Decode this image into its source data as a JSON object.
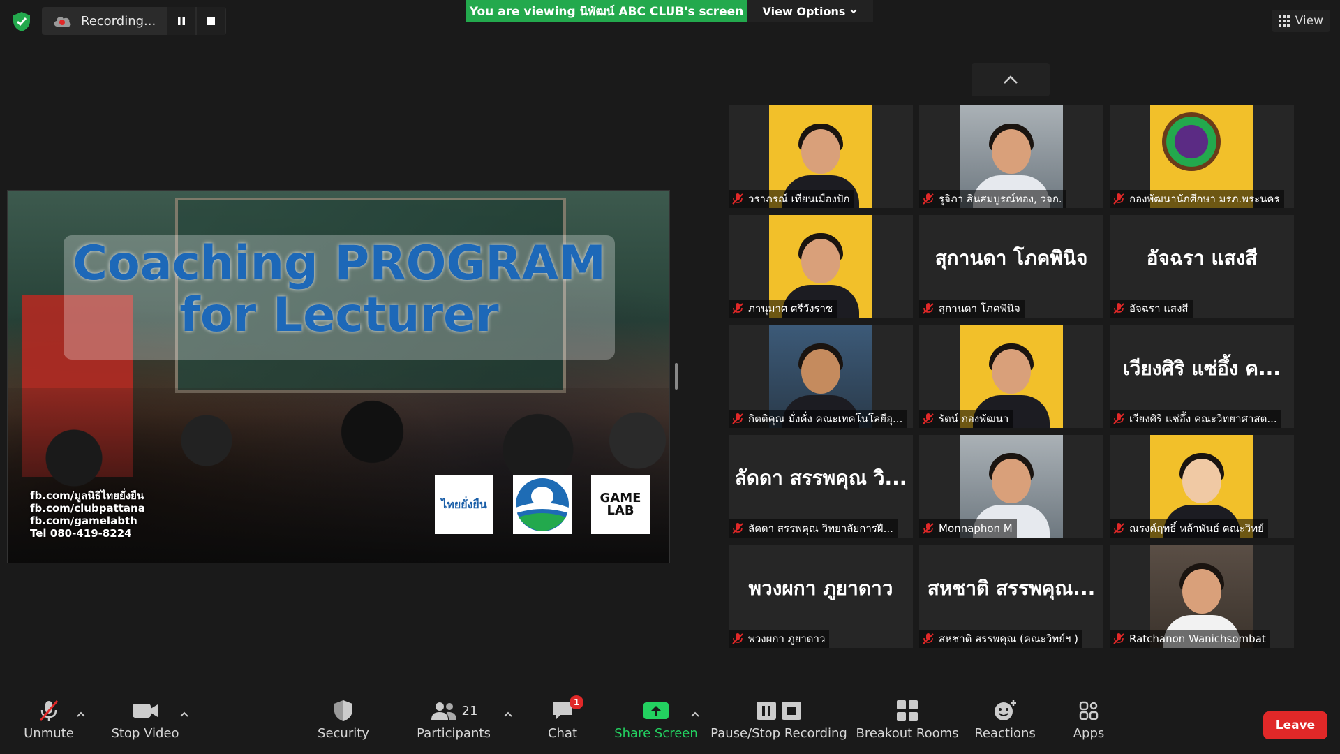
{
  "recording": {
    "label": "Recording..."
  },
  "banner": {
    "viewing": "You are viewing นิพัฒน์ ABC CLUB's screen",
    "view_options": "View Options"
  },
  "view_top": {
    "label": "View"
  },
  "slide": {
    "title_line1": "Coaching PROGRAM",
    "title_line2": "for Lecturer",
    "contacts": [
      "fb.com/มูลนิธิไทยยั่งยืน",
      "fb.com/clubpattana",
      "fb.com/gamelabth",
      "Tel 080-419-8224"
    ],
    "logo1_text": "ไทยยั่งยืน",
    "logo3_text": "GAME LAB"
  },
  "participants": [
    {
      "name": "วราภรณ์ เทียนเมืองปัก",
      "type": "photo-yellow"
    },
    {
      "name": "รุจิภา สินสมบูรณ์ทอง, วจก.",
      "type": "photo"
    },
    {
      "name": "กองพัฒนานักศึกษา มรภ.พระนคร",
      "type": "logo-yellow"
    },
    {
      "name": "ภานุมาศ ศรีวังราช",
      "type": "photo-yellow"
    },
    {
      "name": "สุกานดา โภคพินิจ",
      "display": "สุกานดา โภคพินิจ",
      "type": "name"
    },
    {
      "name": "อัจฉรา แสงสี",
      "display": "อัจฉรา แสงสี",
      "type": "name"
    },
    {
      "name": "กิตติคุณ มั่งคั่ง คณะเทคโนโลยีอุ...",
      "type": "cartoon"
    },
    {
      "name": "รัตน์ กองพัฒนา",
      "type": "photo-yellow"
    },
    {
      "name": "เวียงศิริ แซ่อึ้ง คณะวิทยาศาสต...",
      "display": "เวียงศิริ แซ่อึ้ง ค...",
      "type": "name"
    },
    {
      "name": "ลัดดา สรรพคุณ วิทยาลัยการฝี...",
      "display": "ลัดดา สรรพคุณ วิ...",
      "type": "name"
    },
    {
      "name": "Monnaphon M",
      "type": "photo"
    },
    {
      "name": "ณรงค์ฤทธิ์ หล้าพันธ์ คณะวิทย์",
      "type": "cartoon-yellow"
    },
    {
      "name": "พวงผกา ภูยาดาว",
      "display": "พวงผกา ภูยาดาว",
      "type": "name"
    },
    {
      "name": "สหชาติ สรรพคุณ (คณะวิทย์ฯ )",
      "display": "สหชาติ สรรพคุณ...",
      "type": "name"
    },
    {
      "name": "Ratchanon Wanichsombat",
      "type": "restaurant"
    }
  ],
  "toolbar": {
    "unmute": "Unmute",
    "stop_video": "Stop Video",
    "security": "Security",
    "participants": "Participants",
    "participants_count": "21",
    "chat": "Chat",
    "chat_badge": "1",
    "share_screen": "Share Screen",
    "pause_stop_recording": "Pause/Stop Recording",
    "breakout_rooms": "Breakout Rooms",
    "reactions": "Reactions",
    "apps": "Apps",
    "leave": "Leave"
  },
  "colors": {
    "banner_green": "#23a94d",
    "leave_red": "#e02828",
    "share_green": "#23d160",
    "tile_bg": "#262626"
  }
}
